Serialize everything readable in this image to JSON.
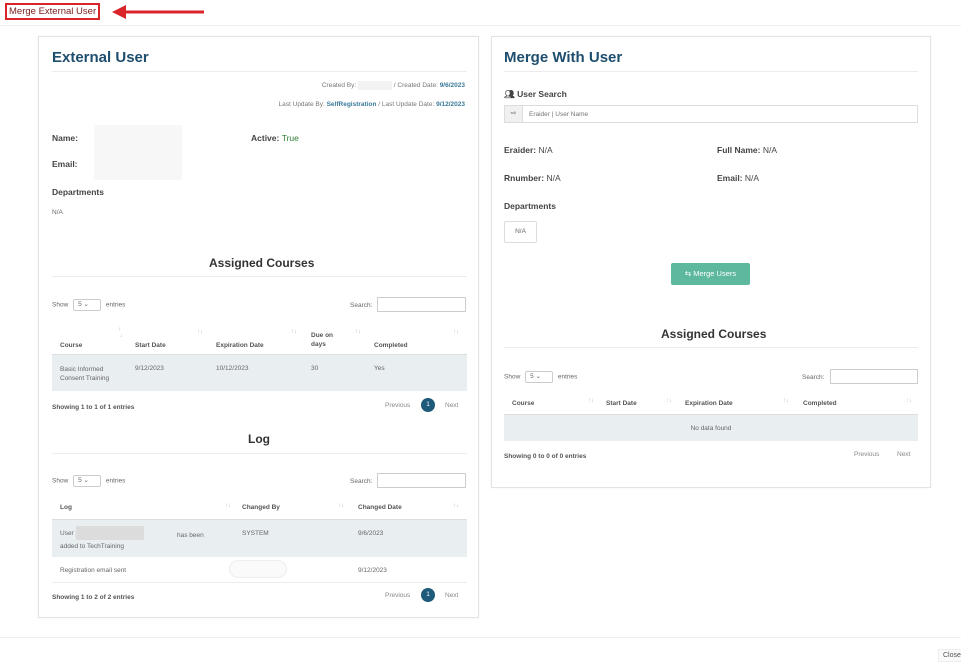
{
  "modal_title": "Merge External User",
  "left": {
    "title": "External User",
    "created_by_label": "Created By:",
    "created_date_label": "/ Created Date:",
    "created_date": "9/6/2023",
    "last_update_label": "Last Update By:",
    "last_update_by": "SelfRegistration",
    "last_update_date_label": "/ Last Update Date:",
    "last_update_date": "9/12/2023",
    "name_label": "Name:",
    "email_label": "Email:",
    "active_label": "Active:",
    "active_value": "True",
    "departments_label": "Departments",
    "departments_value": "N/A",
    "assigned": {
      "title": "Assigned Courses",
      "show_label": "Show",
      "entries_value": "5",
      "entries_label": "entries",
      "search_label": "Search:",
      "columns": [
        "Course",
        "Start Date",
        "Expiration Date",
        "Due on days",
        "Completed"
      ],
      "rows": [
        {
          "course": "Basic Informed Consent Training",
          "start": "9/12/2023",
          "expiration": "10/12/2023",
          "due": "30",
          "completed": "Yes"
        }
      ],
      "showing": "Showing 1 to 1 of 1 entries",
      "previous": "Previous",
      "page": "1",
      "next": "Next"
    },
    "log": {
      "title": "Log",
      "show_label": "Show",
      "entries_value": "5",
      "entries_label": "entries",
      "search_label": "Search:",
      "columns": [
        "Log",
        "Changed By",
        "Changed Date"
      ],
      "row1_prefix": "User [",
      "row1_suffix": "has been added to TechTraining",
      "row1_changed_by": "SYSTEM",
      "row1_date": "9/6/2023",
      "row2_log": "Registration email sent",
      "row2_date": "9/12/2023",
      "showing": "Showing 1 to 2 of 2 entries",
      "previous": "Previous",
      "page": "1",
      "next": "Next"
    }
  },
  "right": {
    "title": "Merge With User",
    "user_search_label": "User Search",
    "search_placeholder": "Eraider | User Name",
    "eraider_label": "Eraider:",
    "eraider_value": "N/A",
    "fullname_label": "Full Name:",
    "fullname_value": "N/A",
    "rnumber_label": "Rnumber:",
    "rnumber_value": "N/A",
    "email_label": "Email:",
    "email_value": "N/A",
    "departments_label": "Departments",
    "departments_value": "N/A",
    "merge_button": "Merge Users",
    "assigned": {
      "title": "Assigned Courses",
      "show_label": "Show",
      "entries_value": "5",
      "entries_label": "entries",
      "search_label": "Search:",
      "columns": [
        "Course",
        "Start Date",
        "Expiration Date",
        "Completed"
      ],
      "empty": "No data found",
      "showing": "Showing 0 to 0 of 0 entries",
      "previous": "Previous",
      "next": "Next"
    }
  },
  "close_button": "Close",
  "colors": {
    "accent": "#1e4e6e",
    "merge_button": "#5db89e",
    "highlight_border": "#d9252a"
  }
}
